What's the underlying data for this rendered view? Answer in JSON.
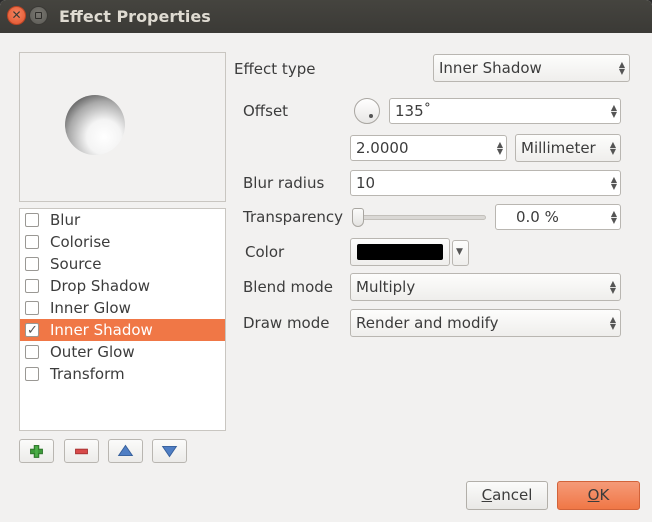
{
  "window": {
    "title": "Effect Properties"
  },
  "effects": [
    {
      "label": "Blur",
      "checked": false,
      "selected": false
    },
    {
      "label": "Colorise",
      "checked": false,
      "selected": false
    },
    {
      "label": "Source",
      "checked": false,
      "selected": false
    },
    {
      "label": "Drop Shadow",
      "checked": false,
      "selected": false
    },
    {
      "label": "Inner Glow",
      "checked": false,
      "selected": false
    },
    {
      "label": "Inner Shadow",
      "checked": true,
      "selected": true
    },
    {
      "label": "Outer Glow",
      "checked": false,
      "selected": false
    },
    {
      "label": "Transform",
      "checked": false,
      "selected": false
    }
  ],
  "toolbar": {
    "add_icon": "plus-icon",
    "remove_icon": "minus-icon",
    "up_icon": "arrow-up-icon",
    "down_icon": "arrow-down-icon"
  },
  "form": {
    "effect_type_label": "Effect type",
    "effect_type_value": "Inner Shadow",
    "offset_label": "Offset",
    "offset_angle": "135˚",
    "offset_distance": "2.0000",
    "offset_unit": "Millimeter",
    "blur_label": "Blur radius",
    "blur_value": "10",
    "transparency_label": "Transparency",
    "transparency_value": "0.0 %",
    "transparency_level": 0,
    "color_label": "Color",
    "color_value": "#000000",
    "blend_label": "Blend mode",
    "blend_value": "Multiply",
    "draw_label": "Draw mode",
    "draw_value": "Render and modify"
  },
  "buttons": {
    "cancel": "Cancel",
    "ok": "OK"
  },
  "colors": {
    "accent": "#f07746",
    "titlebar": "#3c3b37",
    "close": "#e95420"
  }
}
